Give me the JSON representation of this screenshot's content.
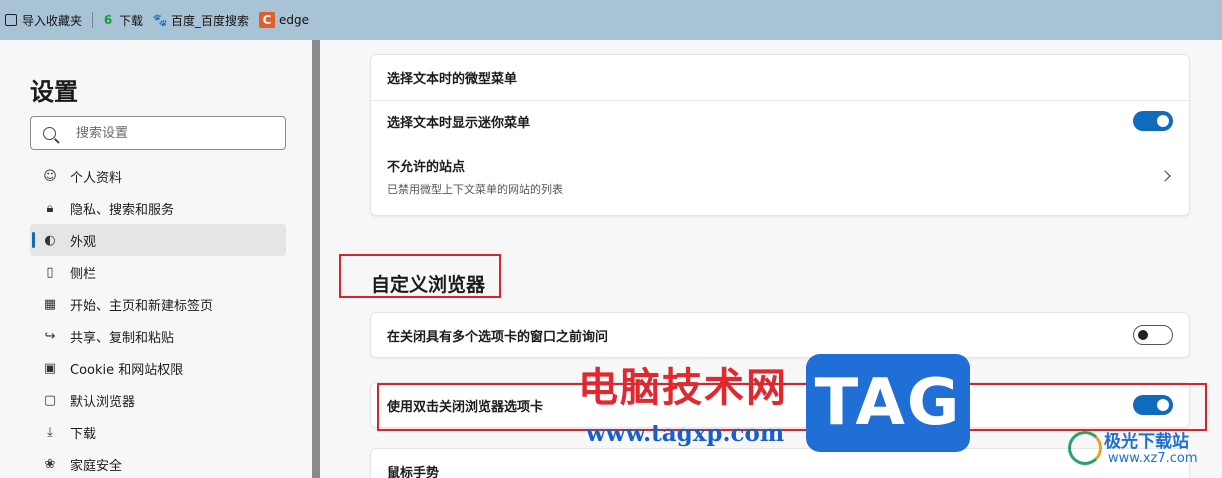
{
  "favorites": [
    {
      "label": "导入收藏夹",
      "icon": "import-icon"
    },
    {
      "label": "下载",
      "icon": "download-site-icon"
    },
    {
      "label": "百度_百度搜索",
      "icon": "baidu-paw-icon"
    },
    {
      "label": "edge",
      "icon": "c-site-icon"
    }
  ],
  "sidebar": {
    "title": "设置",
    "search_placeholder": "搜索设置",
    "items": [
      {
        "label": "个人资料",
        "icon": "profile-icon",
        "active": false
      },
      {
        "label": "隐私、搜索和服务",
        "icon": "lock-icon",
        "active": false
      },
      {
        "label": "外观",
        "icon": "palette-icon",
        "active": true
      },
      {
        "label": "侧栏",
        "icon": "sidebar-icon",
        "active": false
      },
      {
        "label": "开始、主页和新建标签页",
        "icon": "home-icon",
        "active": false
      },
      {
        "label": "共享、复制和粘贴",
        "icon": "share-icon",
        "active": false
      },
      {
        "label": "Cookie 和网站权限",
        "icon": "cookie-icon",
        "active": false
      },
      {
        "label": "默认浏览器",
        "icon": "browser-icon",
        "active": false
      },
      {
        "label": "下载",
        "icon": "download-icon",
        "active": false
      },
      {
        "label": "家庭安全",
        "icon": "family-icon",
        "active": false
      }
    ]
  },
  "main": {
    "mini_menu_card": {
      "header": "选择文本时的微型菜单",
      "show_mini_menu_label": "选择文本时显示迷你菜单",
      "show_mini_menu_on": true,
      "disallowed_sites_label": "不允许的站点",
      "disallowed_sites_sub": "已禁用微型上下文菜单的网站的列表"
    },
    "section_title": "自定义浏览器",
    "ask_before_close_label": "在关闭具有多个选项卡的窗口之前询问",
    "ask_before_close_on": false,
    "double_click_close_label": "使用双击关闭浏览器选项卡",
    "double_click_close_on": true,
    "mouse_gesture_label": "鼠标手势"
  },
  "watermark": {
    "cn_text": "电脑技术网",
    "url": "www.tagxp.com",
    "tag": "TAG",
    "site_cn": "极光下载站",
    "site_url": "www.xz7.com"
  },
  "colors": {
    "accent": "#0f6cbd",
    "highlight_red": "#d7262b",
    "favbar": "#a9c3d6"
  }
}
